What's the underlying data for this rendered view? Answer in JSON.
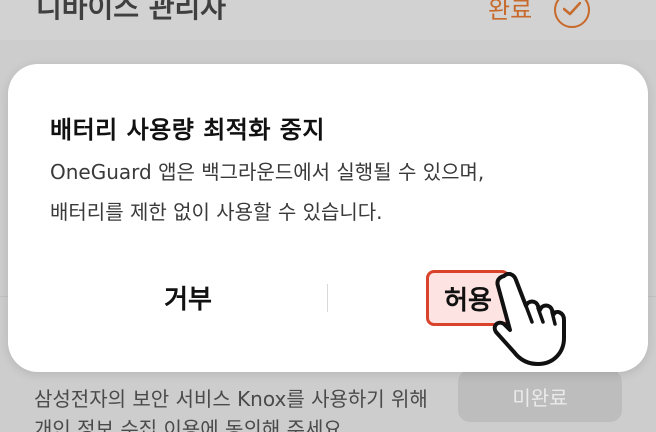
{
  "background": {
    "header_title": "디바이스 관리자",
    "done_label": "완료",
    "description": "삼성전자의 보안 서비스 Knox를 사용하기 위해 개인 정보 수집 이용에 동의해 주세요",
    "pending_label": "미완료"
  },
  "dialog": {
    "title": "배터리 사용량 최적화 중지",
    "body_line1": "OneGuard 앱은 백그라운드에서 실행될 수 있으며,",
    "body_line2": "배터리를 제한 없이 사용할 수 있습니다.",
    "deny_label": "거부",
    "allow_label": "허용"
  },
  "colors": {
    "accent_orange": "#c76a2c",
    "highlight_red": "#d9432c",
    "highlight_fill": "#fde3e1"
  },
  "icons": {
    "done": "check-circle-icon",
    "cursor": "hand-pointer-icon"
  }
}
